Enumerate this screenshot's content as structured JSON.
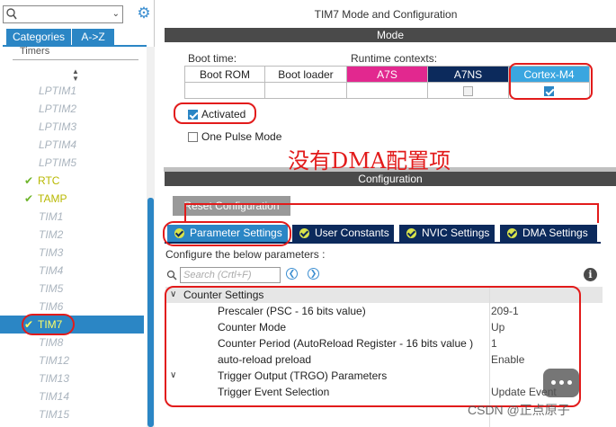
{
  "window": {
    "title": "TIM7 Mode and Configuration"
  },
  "left_panel": {
    "tabs": [
      "Categories",
      "A->Z"
    ],
    "category": "Timers",
    "items": [
      {
        "label": "LPTIM1",
        "state": "disabled"
      },
      {
        "label": "LPTIM2",
        "state": "disabled"
      },
      {
        "label": "LPTIM3",
        "state": "disabled"
      },
      {
        "label": "LPTIM4",
        "state": "disabled"
      },
      {
        "label": "LPTIM5",
        "state": "disabled"
      },
      {
        "label": "RTC",
        "state": "enabled"
      },
      {
        "label": "TAMP",
        "state": "enabled"
      },
      {
        "label": "TIM1",
        "state": "disabled"
      },
      {
        "label": "TIM2",
        "state": "disabled"
      },
      {
        "label": "TIM3",
        "state": "disabled"
      },
      {
        "label": "TIM4",
        "state": "disabled"
      },
      {
        "label": "TIM5",
        "state": "disabled"
      },
      {
        "label": "TIM6",
        "state": "disabled"
      },
      {
        "label": "TIM7",
        "state": "selected"
      },
      {
        "label": "TIM8",
        "state": "disabled"
      },
      {
        "label": "TIM12",
        "state": "disabled"
      },
      {
        "label": "TIM13",
        "state": "disabled"
      },
      {
        "label": "TIM14",
        "state": "disabled"
      },
      {
        "label": "TIM15",
        "state": "disabled"
      }
    ]
  },
  "mode": {
    "header": "Mode",
    "boot_time_label": "Boot time:",
    "runtime_label": "Runtime contexts:",
    "columns": [
      "Boot ROM",
      "Boot loader",
      "A7S",
      "A7NS",
      "Cortex-M4"
    ],
    "checks": {
      "a7ns": false,
      "cortex_m4": true
    },
    "options": [
      {
        "label": "Activated",
        "checked": true
      },
      {
        "label": "One Pulse Mode",
        "checked": false
      }
    ]
  },
  "annotation": "没有DMA配置项",
  "configuration": {
    "header": "Configuration",
    "reset_button": "Reset Configuration",
    "tabs": [
      "Parameter Settings",
      "User Constants",
      "NVIC Settings",
      "DMA Settings"
    ],
    "caption": "Configure the below parameters :",
    "search_placeholder": "Search (Crtl+F)",
    "params": [
      {
        "type": "group",
        "name": "Counter Settings",
        "value": ""
      },
      {
        "type": "param",
        "name": "Prescaler (PSC - 16 bits value)",
        "value": "209-1"
      },
      {
        "type": "param",
        "name": "Counter Mode",
        "value": "Up"
      },
      {
        "type": "param",
        "name": "Counter Period (AutoReload Register - 16 bits value )",
        "value": "1"
      },
      {
        "type": "param",
        "name": "auto-reload preload",
        "value": "Enable"
      },
      {
        "type": "group",
        "name": "Trigger Output (TRGO) Parameters",
        "value": ""
      },
      {
        "type": "param",
        "name": "Trigger Event Selection",
        "value": "Update Event"
      }
    ]
  },
  "watermark": "CSDN @正点原子",
  "colors": {
    "accent": "#2b86c5",
    "dark_tab": "#0c2a5c",
    "a7s": "#e2288f",
    "annotation_red": "#e21b1b"
  }
}
